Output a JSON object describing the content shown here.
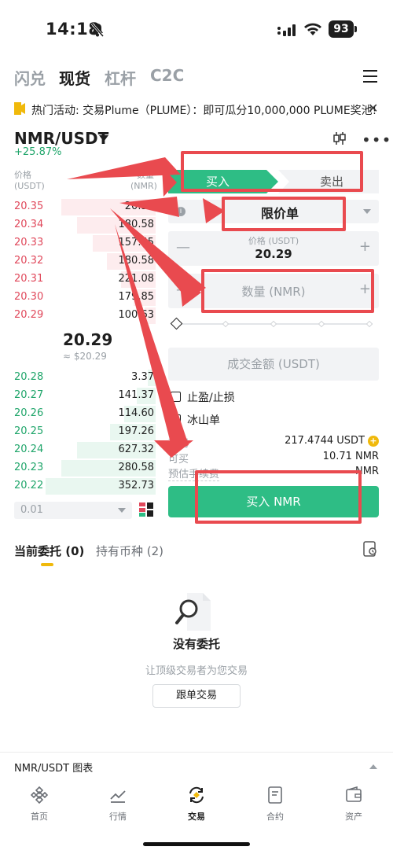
{
  "status_bar": {
    "time": "14:18",
    "battery": "93"
  },
  "top_tabs": [
    {
      "label": "闪兑",
      "active": false
    },
    {
      "label": "现货",
      "active": true
    },
    {
      "label": "杠杆",
      "active": false
    },
    {
      "label": "C2C",
      "active": false
    }
  ],
  "announcement": "热门活动: 交易Plume（PLUME）：即可瓜分10,000,000 PLUME奖池!",
  "pair": {
    "symbol": "NMR/USDT",
    "change": "+25.87%"
  },
  "orderbook": {
    "price_header": "价格",
    "price_unit": "(USDT)",
    "qty_header": "数量",
    "qty_unit": "(NMR)",
    "asks": [
      {
        "price": "20.35",
        "qty": "20.32"
      },
      {
        "price": "20.34",
        "qty": "180.58"
      },
      {
        "price": "20.33",
        "qty": "157.55"
      },
      {
        "price": "20.32",
        "qty": "180.58"
      },
      {
        "price": "20.31",
        "qty": "221.08"
      },
      {
        "price": "20.30",
        "qty": "179.85"
      },
      {
        "price": "20.29",
        "qty": "100.63"
      }
    ],
    "last_price": "20.29",
    "last_usd": "≈ $20.29",
    "bids": [
      {
        "price": "20.28",
        "qty": "3.37"
      },
      {
        "price": "20.27",
        "qty": "141.37"
      },
      {
        "price": "20.26",
        "qty": "114.60"
      },
      {
        "price": "20.25",
        "qty": "197.26"
      },
      {
        "price": "20.24",
        "qty": "627.32"
      },
      {
        "price": "20.23",
        "qty": "280.58"
      },
      {
        "price": "20.22",
        "qty": "352.73"
      }
    ],
    "depth": "0.01"
  },
  "form": {
    "buy_tab": "买入",
    "sell_tab": "卖出",
    "order_type": "限价单",
    "price_caption": "价格 (USDT)",
    "price_value": "20.29",
    "qty_placeholder": "数量 (NMR)",
    "amount_placeholder": "成交金额 (USDT)",
    "tp_sl_label": "止盈/止损",
    "iceberg_label": "冰山单",
    "available_label": "可用",
    "available_value": "217.4744 USDT",
    "can_buy_label": "可买",
    "can_buy_value": "10.71 NMR",
    "fee_label": "预估手续费",
    "fee_value": "NMR",
    "buy_button": "买入 NMR"
  },
  "orders": {
    "tab_open": "当前委托 (0)",
    "tab_holdings": "持有币种 (2)",
    "empty_title": "没有委托",
    "empty_subtitle": "让顶级交易者为您交易",
    "copy_trade_button": "跟单交易"
  },
  "chart_bar_label": "NMR/USDT 图表",
  "bottom_nav": [
    {
      "label": "首页",
      "icon": "home-icon"
    },
    {
      "label": "行情",
      "icon": "markets-icon"
    },
    {
      "label": "交易",
      "icon": "trade-icon"
    },
    {
      "label": "合约",
      "icon": "futures-icon"
    },
    {
      "label": "资产",
      "icon": "wallet-icon"
    }
  ],
  "colors": {
    "buy": "#2ebd85",
    "sell": "#e0485b",
    "accent": "#f0b90b",
    "annotation": "#e94a4f"
  }
}
